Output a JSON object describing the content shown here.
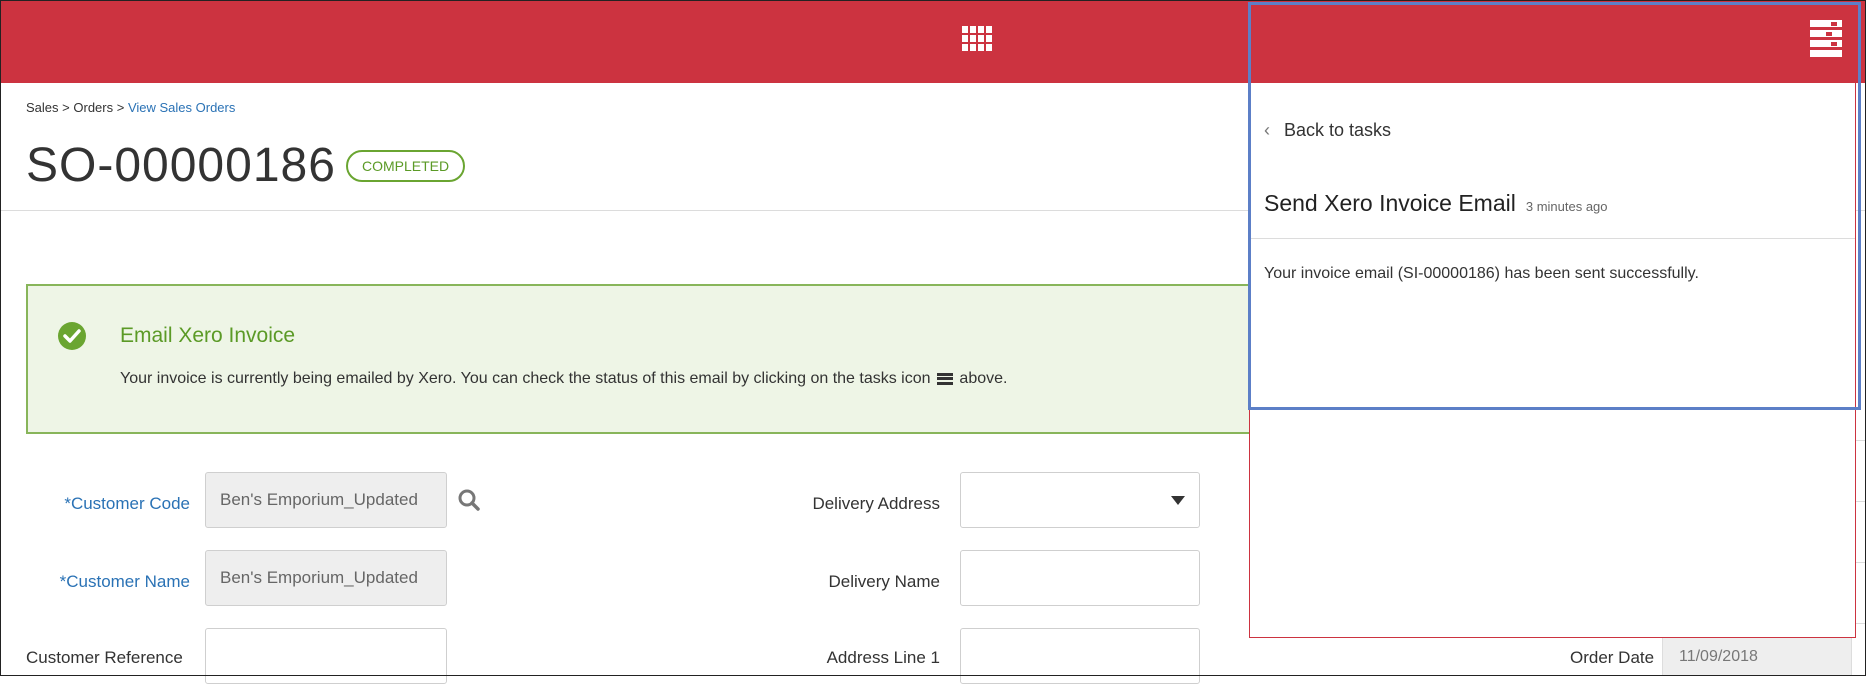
{
  "breadcrumb": {
    "part1": "Sales",
    "sep": ">",
    "part2": "Orders",
    "part3": "View Sales Orders"
  },
  "page": {
    "title": "SO-00000186",
    "status": "COMPLETED"
  },
  "alert": {
    "title": "Email Xero Invoice",
    "text_before": "Your invoice is currently being emailed by Xero. You can check the status of this email by clicking on the tasks icon",
    "text_after": "above."
  },
  "form": {
    "customer_code_label": "*Customer Code",
    "customer_code_value": "Ben's Emporium_Updated",
    "customer_name_label": "*Customer Name",
    "customer_name_value": "Ben's Emporium_Updated",
    "customer_reference_label": "Customer Reference",
    "delivery_address_label": "Delivery Address",
    "delivery_name_label": "Delivery Name",
    "address_line1_label": "Address Line 1",
    "order_date_label": "Order Date",
    "order_date_value": "11/09/2018"
  },
  "tasks_panel": {
    "back_label": "Back to tasks",
    "back_glyph": "‹",
    "task_title": "Send Xero Invoice Email",
    "task_time": "3 minutes ago",
    "task_message": "Your invoice email (SI-00000186) has been sent successfully."
  },
  "colors": {
    "brand_red": "#cc3340",
    "success_green": "#6aa531",
    "link_blue": "#2a72b5",
    "highlight_blue": "#5c7fc7"
  },
  "icons": {
    "apps": "apps-grid-icon",
    "tasks": "tasks-icon",
    "search": "search-icon",
    "check": "check-circle-icon"
  }
}
